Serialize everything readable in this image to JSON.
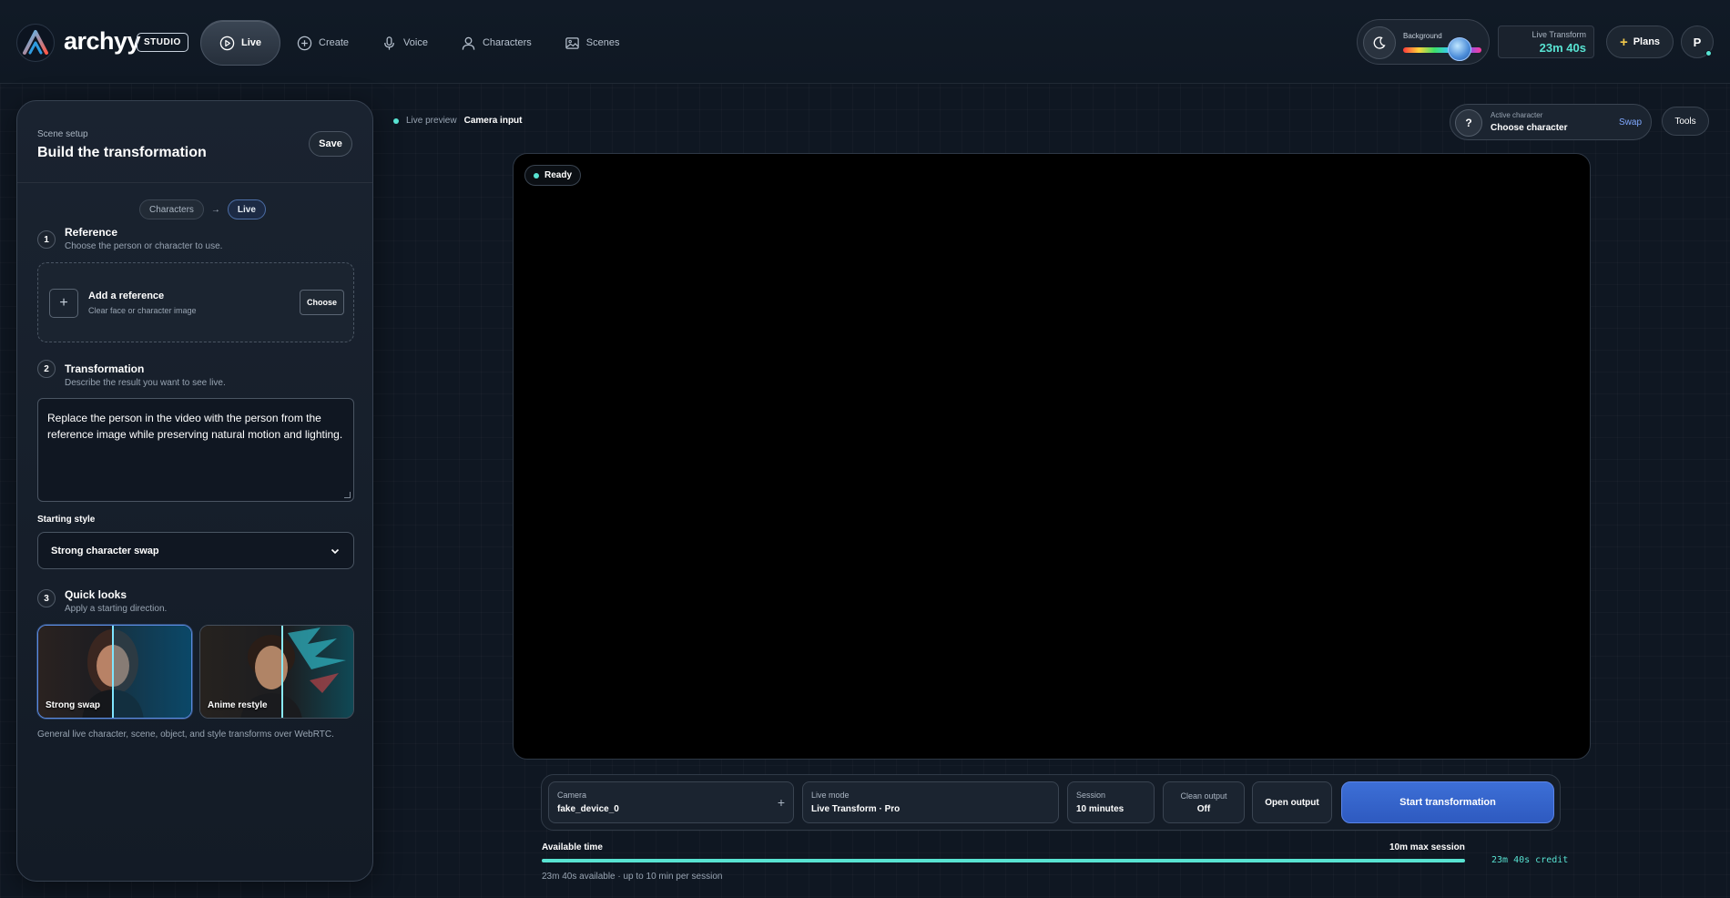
{
  "brand": {
    "name": "archyy",
    "badge": "STUDIO"
  },
  "nav": {
    "items": [
      {
        "label": "Live",
        "icon": "play-circle-icon",
        "active": true
      },
      {
        "label": "Create",
        "icon": "plus-circle-icon",
        "active": false
      },
      {
        "label": "Voice",
        "icon": "microphone-icon",
        "active": false
      },
      {
        "label": "Characters",
        "icon": "person-icon",
        "active": false
      },
      {
        "label": "Scenes",
        "icon": "image-icon",
        "active": false
      }
    ]
  },
  "header": {
    "background_label": "Background",
    "background_level": 0.72,
    "live_transform_label": "Live Transform",
    "live_transform_value": "23m 40s",
    "plans_label": "Plans",
    "avatar_initial": "P"
  },
  "panel": {
    "kicker": "Scene setup",
    "title": "Build the transformation",
    "save_label": "Save",
    "flow": {
      "from": "Characters",
      "arrow": "→",
      "to": "Live"
    },
    "steps": [
      {
        "num": "1",
        "title": "Reference",
        "sub": "Choose the person or character to use."
      },
      {
        "num": "2",
        "title": "Transformation",
        "sub": "Describe the result you want to see live."
      },
      {
        "num": "3",
        "title": "Quick looks",
        "sub": "Apply a starting direction."
      }
    ],
    "reference": {
      "plus": "+",
      "title": "Add a reference",
      "sub": "Clear face or character image",
      "choose_label": "Choose"
    },
    "prompt": "Replace the person in the video with the person from the reference image while preserving natural motion and lighting.",
    "starting_style": {
      "label": "Starting style",
      "value": "Strong character swap"
    },
    "looks": [
      {
        "label": "Strong swap",
        "selected": true
      },
      {
        "label": "Anime restyle",
        "selected": false
      }
    ],
    "footer": "General live character, scene, object, and style transforms over WebRTC."
  },
  "preview": {
    "muted_label": "Live preview",
    "strong_label": "Camera input",
    "status": "Ready",
    "active_character": {
      "label": "Active character",
      "value": "Choose character",
      "swap_label": "Swap",
      "question": "?"
    },
    "tools_label": "Tools"
  },
  "controls": {
    "camera": {
      "label": "Camera",
      "value": "fake_device_0",
      "plus": "+"
    },
    "live_mode": {
      "label": "Live mode",
      "value": "Live Transform · Pro"
    },
    "session": {
      "label": "Session",
      "value": "10 minutes"
    },
    "clean_output": {
      "label": "Clean output",
      "value": "Off"
    },
    "open_output_label": "Open output",
    "start_label": "Start transformation"
  },
  "availability": {
    "label": "Available time",
    "max_label": "10m max session",
    "credit": "23m 40s credit",
    "sub": "23m 40s available · up to 10 min per session",
    "fill": 1.0
  },
  "colors": {
    "accent_teal": "#58e3d2",
    "accent_blue": "#3d6fd6",
    "swap_link": "#7fa8ff"
  }
}
